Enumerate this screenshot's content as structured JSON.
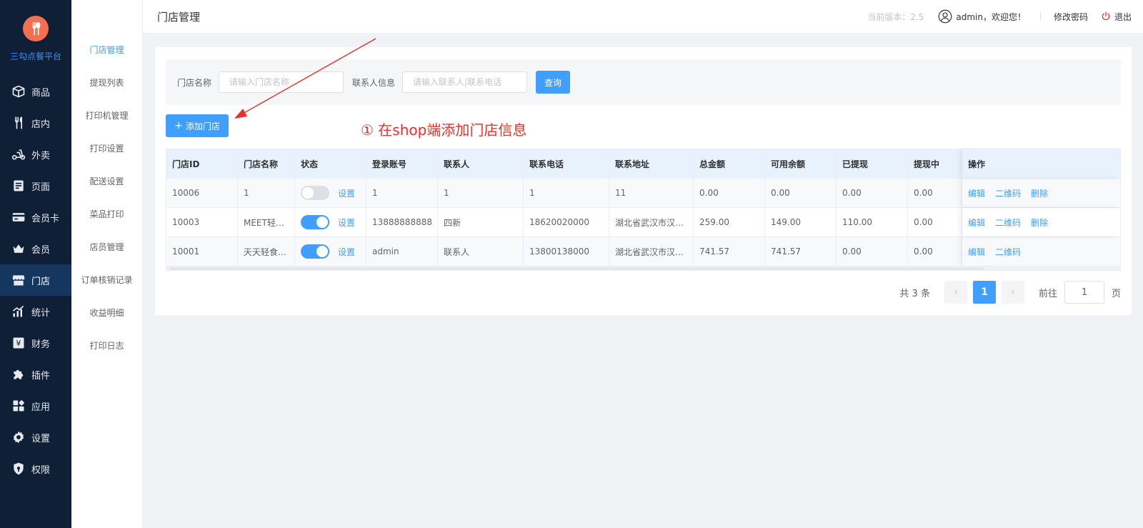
{
  "sidebar": {
    "logo_text": "三勾点餐平台",
    "items": [
      {
        "label": "商品",
        "icon": "goods-box-icon"
      },
      {
        "label": "店内",
        "icon": "fork-knife-icon"
      },
      {
        "label": "外卖",
        "icon": "scooter-icon"
      },
      {
        "label": "页面",
        "icon": "page-icon"
      },
      {
        "label": "会员卡",
        "icon": "card-icon"
      },
      {
        "label": "会员",
        "icon": "crown-icon"
      },
      {
        "label": "门店",
        "icon": "store-icon"
      },
      {
        "label": "统计",
        "icon": "chart-icon"
      },
      {
        "label": "财务",
        "icon": "finance-icon"
      },
      {
        "label": "插件",
        "icon": "puzzle-icon"
      },
      {
        "label": "应用",
        "icon": "apps-icon"
      },
      {
        "label": "设置",
        "icon": "gear-icon"
      },
      {
        "label": "权限",
        "icon": "shield-icon"
      }
    ],
    "active_index": 6
  },
  "subnav": {
    "items": [
      "门店管理",
      "提现列表",
      "打印机管理",
      "打印设置",
      "配送设置",
      "菜品打印",
      "店员管理",
      "订单核销记录",
      "收益明细",
      "打印日志"
    ],
    "active_index": 0
  },
  "header": {
    "title": "门店管理",
    "version": "当前版本：2.5",
    "user": "admin，欢迎您！",
    "change_password": "修改密码",
    "logout": "退出"
  },
  "filter": {
    "store_name_label": "门店名称",
    "store_name_placeholder": "请输入门店名称",
    "contact_label": "联系人信息",
    "contact_placeholder": "请输入联系人|联系电话",
    "query_button": "查询"
  },
  "add_button": "添加门店",
  "annotation": "① 在shop端添加门店信息",
  "table": {
    "headers": [
      "门店ID",
      "门店名称",
      "状态",
      "登录账号",
      "联系人",
      "联系电话",
      "联系地址",
      "总金额",
      "可用余额",
      "已提现",
      "提现中",
      "操作"
    ],
    "status_link": "设置",
    "actions": {
      "edit": "编辑",
      "qrcode": "二维码",
      "delete": "删除"
    },
    "rows": [
      {
        "id": "10006",
        "name": "1",
        "enabled": false,
        "account": "1",
        "contact": "1",
        "phone": "1",
        "address": "11",
        "total": "0.00",
        "balance": "0.00",
        "withdrawn": "0.00",
        "pending": "0.00",
        "can_delete": true
      },
      {
        "id": "10003",
        "name": "MEET轻…",
        "enabled": true,
        "account": "13888888888",
        "contact": "四新",
        "phone": "18620020000",
        "address": "湖北省武汉市汉…",
        "total": "259.00",
        "balance": "149.00",
        "withdrawn": "110.00",
        "pending": "0.00",
        "can_delete": true
      },
      {
        "id": "10001",
        "name": "天天轻食…",
        "enabled": true,
        "account": "admin",
        "contact": "联系人",
        "phone": "13800138000",
        "address": "湖北省武汉市汉…",
        "total": "741.57",
        "balance": "741.57",
        "withdrawn": "0.00",
        "pending": "0.00",
        "can_delete": false
      }
    ]
  },
  "pagination": {
    "total_text": "共 3 条",
    "current_page": "1",
    "goto_label": "前往",
    "goto_value": "1",
    "page_suffix": "页"
  },
  "colors": {
    "primary": "#409eff",
    "sidebar_bg": "#0e1f36",
    "annotation": "#e8312a",
    "logo": "#f2704f"
  }
}
